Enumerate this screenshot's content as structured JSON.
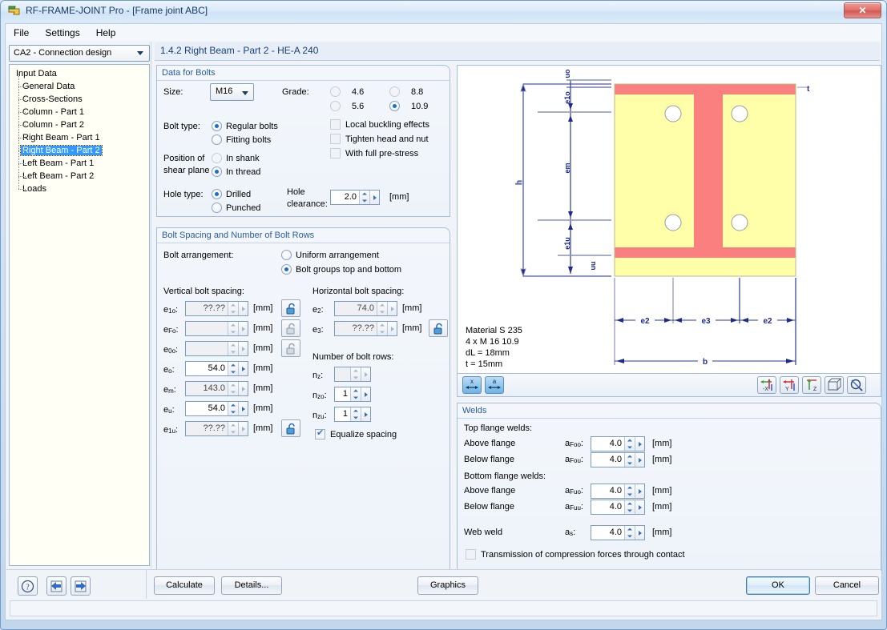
{
  "window": {
    "title": "RF-FRAME-JOINT Pro - [Frame joint ABC]",
    "close_label": "✕"
  },
  "menu": {
    "items": [
      "File",
      "Settings",
      "Help"
    ]
  },
  "combo": {
    "value": "CA2 - Connection design"
  },
  "breadcrumb": {
    "text": "1.4.2 Right Beam - Part 2 - HE-A 240"
  },
  "tree": {
    "root": "Input Data",
    "items": [
      {
        "label": "General Data",
        "selected": false
      },
      {
        "label": "Cross-Sections",
        "selected": false
      },
      {
        "label": "Column - Part 1",
        "selected": false
      },
      {
        "label": "Column - Part 2",
        "selected": false
      },
      {
        "label": "Right Beam - Part 1",
        "selected": false
      },
      {
        "label": "Right Beam - Part 2",
        "selected": true
      },
      {
        "label": "Left Beam - Part 1",
        "selected": false
      },
      {
        "label": "Left Beam - Part 2",
        "selected": false
      },
      {
        "label": "Loads",
        "selected": false
      }
    ]
  },
  "bolts": {
    "title": "Data for Bolts",
    "size_label": "Size:",
    "size_value": "M16",
    "grade_label": "Grade:",
    "grades": [
      {
        "label": "4.6",
        "selected": false
      },
      {
        "label": "8.8",
        "selected": false
      },
      {
        "label": "5.6",
        "selected": false
      },
      {
        "label": "10.9",
        "selected": true
      }
    ],
    "bolt_type_label": "Bolt type:",
    "bolt_types": [
      {
        "label": "Regular bolts",
        "selected": true
      },
      {
        "label": "Fitting bolts",
        "selected": false
      }
    ],
    "shear_plane_label_1": "Position of",
    "shear_plane_label_2": "shear plane",
    "shear_planes": [
      {
        "label": "In shank",
        "selected": false
      },
      {
        "label": "In thread",
        "selected": true
      }
    ],
    "hole_type_label": "Hole type:",
    "hole_types": [
      {
        "label": "Drilled",
        "selected": true
      },
      {
        "label": "Punched",
        "selected": false
      }
    ],
    "hole_clearance_label_1": "Hole",
    "hole_clearance_label_2": "clearance:",
    "hole_clearance_value": "2.0",
    "hole_clearance_unit": "[mm]",
    "checkboxes": [
      {
        "label": "Local buckling effects",
        "checked": false
      },
      {
        "label": "Tighten head and nut",
        "checked": false
      },
      {
        "label": "With full pre-stress",
        "checked": false
      }
    ]
  },
  "spacing": {
    "title": "Bolt Spacing and Number of Bolt Rows",
    "arrangement_label": "Bolt arrangement:",
    "arrangements": [
      {
        "label": "Uniform arrangement",
        "selected": false
      },
      {
        "label": "Bolt groups top and bottom",
        "selected": true
      }
    ],
    "vertical_title": "Vertical bolt spacing:",
    "vertical_rows": [
      {
        "sym": "e",
        "sub": "1o",
        "value": "??.??",
        "unit": "[mm]",
        "readonly": true,
        "lock": "locked"
      },
      {
        "sym": "e",
        "sub": "Fo",
        "value": "",
        "unit": "[mm]",
        "readonly": true,
        "lock": "unlocked"
      },
      {
        "sym": "e",
        "sub": "0o",
        "value": "",
        "unit": "[mm]",
        "readonly": true,
        "lock": "unlocked"
      },
      {
        "sym": "e",
        "sub": "o",
        "value": "54.0",
        "unit": "[mm]",
        "readonly": false,
        "lock": "none"
      },
      {
        "sym": "e",
        "sub": "m",
        "value": "143.0",
        "unit": "[mm]",
        "readonly": true,
        "lock": "none"
      },
      {
        "sym": "e",
        "sub": "u",
        "value": "54.0",
        "unit": "[mm]",
        "readonly": false,
        "lock": "none"
      },
      {
        "sym": "e",
        "sub": "1u",
        "value": "??.??",
        "unit": "[mm]",
        "readonly": true,
        "lock": "locked"
      }
    ],
    "horizontal_title": "Horizontal bolt spacing:",
    "horizontal_rows": [
      {
        "sym": "e",
        "sub": "2",
        "value": "74.0",
        "unit": "[mm]",
        "readonly": true,
        "lock": "none"
      },
      {
        "sym": "e",
        "sub": "3",
        "value": "??.??",
        "unit": "[mm]",
        "readonly": true,
        "lock": "locked"
      }
    ],
    "rows_title": "Number of bolt rows:",
    "row_counts": [
      {
        "sym": "n",
        "sub": "z",
        "value": "",
        "readonly": true
      },
      {
        "sym": "n",
        "sub": "zo",
        "value": "1",
        "readonly": false
      },
      {
        "sym": "n",
        "sub": "zu",
        "value": "1",
        "readonly": false
      }
    ],
    "equalize_label": "Equalize spacing",
    "equalize_checked": true
  },
  "graphic": {
    "dimensions_vertical": [
      "uo",
      "e1o",
      "em",
      "e1u",
      "uu",
      "h"
    ],
    "dimensions_horizontal": [
      "e2",
      "e3",
      "e2",
      "b"
    ],
    "thickness_label": "t",
    "annotations": [
      "Material S 235",
      "4 x M 16 10.9",
      "dL = 18mm",
      "t = 15mm"
    ],
    "colors": {
      "flange": "#FA7F7F",
      "web_fill": "#FFFFAA",
      "dim_line": "#1d2b8c",
      "hole": "#ffffff"
    },
    "toolbar_left": [
      "x-dimension-icon",
      "a-dimension-icon"
    ],
    "toolbar_right": [
      "view-minus-x-icon",
      "view-y-icon",
      "view-z-icon",
      "isometric-view-icon",
      "zoom-icon"
    ]
  },
  "welds": {
    "title": "Welds",
    "top_flange_title": "Top flange welds:",
    "bottom_flange_title": "Bottom flange welds:",
    "rows": [
      {
        "label": "Above flange",
        "sym": "a",
        "sub": "Foo",
        "value": "4.0",
        "unit": "[mm]"
      },
      {
        "label": "Below flange",
        "sym": "a",
        "sub": "Fou",
        "value": "4.0",
        "unit": "[mm]"
      },
      {
        "label": "Above flange",
        "sym": "a",
        "sub": "Fuo",
        "value": "4.0",
        "unit": "[mm]"
      },
      {
        "label": "Below flange",
        "sym": "a",
        "sub": "Fuu",
        "value": "4.0",
        "unit": "[mm]"
      },
      {
        "label": "Web weld",
        "sym": "a",
        "sub": "s",
        "value": "4.0",
        "unit": "[mm]"
      }
    ],
    "transmission_label": "Transmission of compression forces through contact",
    "transmission_checked": false
  },
  "footer": {
    "help_icon": "help-icon",
    "prev_icon": "previous-icon",
    "next_icon": "next-icon",
    "calculate": "Calculate",
    "details": "Details...",
    "graphics": "Graphics",
    "ok": "OK",
    "cancel": "Cancel"
  }
}
